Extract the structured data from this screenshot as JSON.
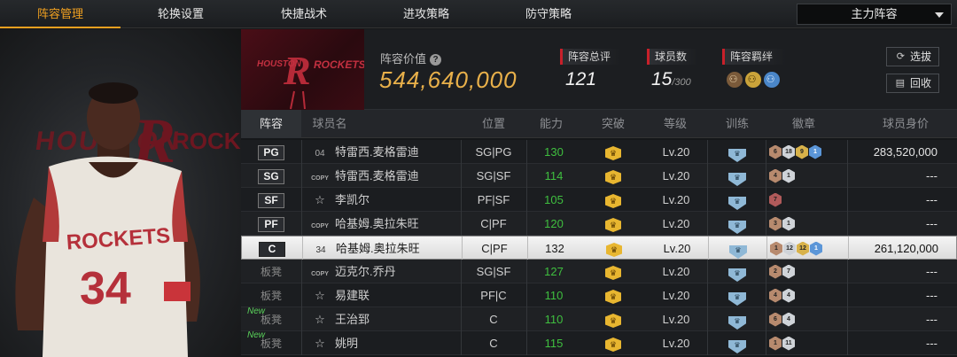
{
  "tabs": [
    {
      "label": "阵容管理",
      "active": true
    },
    {
      "label": "轮换设置",
      "active": false
    },
    {
      "label": "快捷战术",
      "active": false
    },
    {
      "label": "进攻策略",
      "active": false
    },
    {
      "label": "防守策略",
      "active": false
    }
  ],
  "lineup_select": {
    "value": "主力阵容"
  },
  "team": {
    "logo_text_left": "HOUSTON",
    "logo_text_right": "ROCKETS"
  },
  "lineup_value": {
    "label": "阵容价值",
    "value": "544,640,000"
  },
  "stats": [
    {
      "label": "阵容总评",
      "value": "121",
      "suffix": ""
    },
    {
      "label": "球员数",
      "value": "15",
      "suffix": "/300"
    },
    {
      "label": "阵容羁绊",
      "value": "",
      "suffix": ""
    }
  ],
  "buttons": {
    "select": "选拔",
    "recycle": "回收"
  },
  "columns": [
    "阵容",
    "球员名",
    "位置",
    "能力",
    "突破",
    "等级",
    "训练",
    "徽章",
    "球员身价"
  ],
  "players": [
    {
      "slot": "PG",
      "bench": false,
      "new": false,
      "tag": "04",
      "name": "特雷西.麦格雷迪",
      "position": "SG|PG",
      "ability": "130",
      "level": "Lv.20",
      "badges": [
        "6",
        "18",
        "9",
        "1"
      ],
      "value": "283,520,000",
      "selected": false
    },
    {
      "slot": "SG",
      "bench": false,
      "new": false,
      "tag": "COPY",
      "name": "特雷西.麦格雷迪",
      "position": "SG|SF",
      "ability": "114",
      "level": "Lv.20",
      "badges": [
        "4",
        "1"
      ],
      "value": "---",
      "selected": false
    },
    {
      "slot": "SF",
      "bench": false,
      "new": false,
      "tag": "star",
      "name": "李凯尔",
      "position": "PF|SF",
      "ability": "105",
      "level": "Lv.20",
      "badges": [
        "7"
      ],
      "value": "---",
      "selected": false
    },
    {
      "slot": "PF",
      "bench": false,
      "new": false,
      "tag": "COPY",
      "name": "哈基姆.奥拉朱旺",
      "position": "C|PF",
      "ability": "120",
      "level": "Lv.20",
      "badges": [
        "3",
        "1"
      ],
      "value": "---",
      "selected": false
    },
    {
      "slot": "C",
      "bench": false,
      "new": false,
      "tag": "34",
      "name": "哈基姆.奥拉朱旺",
      "position": "C|PF",
      "ability": "132",
      "level": "Lv.20",
      "badges": [
        "1",
        "12",
        "12",
        "1"
      ],
      "value": "261,120,000",
      "selected": true
    },
    {
      "slot": "板凳",
      "bench": true,
      "new": false,
      "tag": "COPY",
      "name": "迈克尔.乔丹",
      "position": "SG|SF",
      "ability": "127",
      "level": "Lv.20",
      "badges": [
        "2",
        "7"
      ],
      "value": "---",
      "selected": false
    },
    {
      "slot": "板凳",
      "bench": true,
      "new": false,
      "tag": "star",
      "name": "易建联",
      "position": "PF|C",
      "ability": "110",
      "level": "Lv.20",
      "badges": [
        "4",
        "4"
      ],
      "value": "---",
      "selected": false
    },
    {
      "slot": "板凳",
      "bench": true,
      "new": true,
      "tag": "star",
      "name": "王治郅",
      "position": "C",
      "ability": "110",
      "level": "Lv.20",
      "badges": [
        "6",
        "4"
      ],
      "value": "---",
      "selected": false
    },
    {
      "slot": "板凳",
      "bench": true,
      "new": true,
      "tag": "star",
      "name": "姚明",
      "position": "C",
      "ability": "115",
      "level": "Lv.20",
      "badges": [
        "1",
        "11"
      ],
      "value": "---",
      "selected": false
    }
  ],
  "new_label": "New",
  "player_art": {
    "jersey_text": "ROCKETS",
    "jersey_number": "34",
    "bg_text": "HOUSTON"
  },
  "colors": {
    "accent": "#f0a020",
    "value_gold": "#e8b04a",
    "ability_green": "#3fbf3f",
    "stat_red": "#c8202a"
  }
}
